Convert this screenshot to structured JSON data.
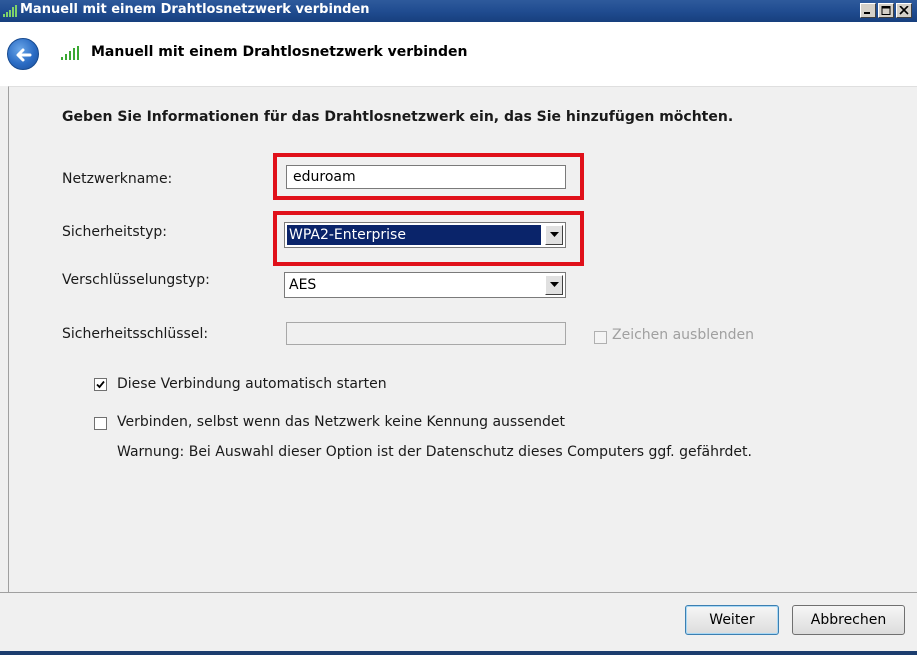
{
  "window": {
    "title": "Manuell mit einem Drahtlosnetzwerk verbinden",
    "controls": [
      "minimize",
      "maximize",
      "close"
    ]
  },
  "header": {
    "back_icon": "back-arrow-icon",
    "wifi_icon": "wifi-signal-icon",
    "title": "Manuell mit einem Drahtlosnetzwerk verbinden"
  },
  "form": {
    "intro": "Geben Sie Informationen für das Drahtlosnetzwerk ein, das Sie hinzufügen möchten.",
    "network_name": {
      "label": "Netzwerkname:",
      "value": "eduroam"
    },
    "security_type": {
      "label": "Sicherheitstyp:",
      "value": "WPA2-Enterprise"
    },
    "encryption_type": {
      "label": "Verschlüsselungstyp:",
      "value": "AES"
    },
    "security_key": {
      "label": "Sicherheitsschlüssel:",
      "value": "",
      "hide_chars_label": "Zeichen ausblenden",
      "hide_chars_checked": false,
      "enabled": false
    },
    "auto_start": {
      "label": "Diese Verbindung automatisch starten",
      "checked": true
    },
    "connect_hidden": {
      "label": "Verbinden, selbst wenn das Netzwerk keine Kennung aussendet",
      "checked": false
    },
    "warning": "Warnung: Bei Auswahl dieser Option ist der Datenschutz dieses Computers ggf. gefährdet."
  },
  "footer": {
    "next_label": "Weiter",
    "cancel_label": "Abbrechen"
  },
  "colors": {
    "highlight": "#e0101a",
    "selection": "#0a246a",
    "titlebar": "#1f4b8f"
  }
}
